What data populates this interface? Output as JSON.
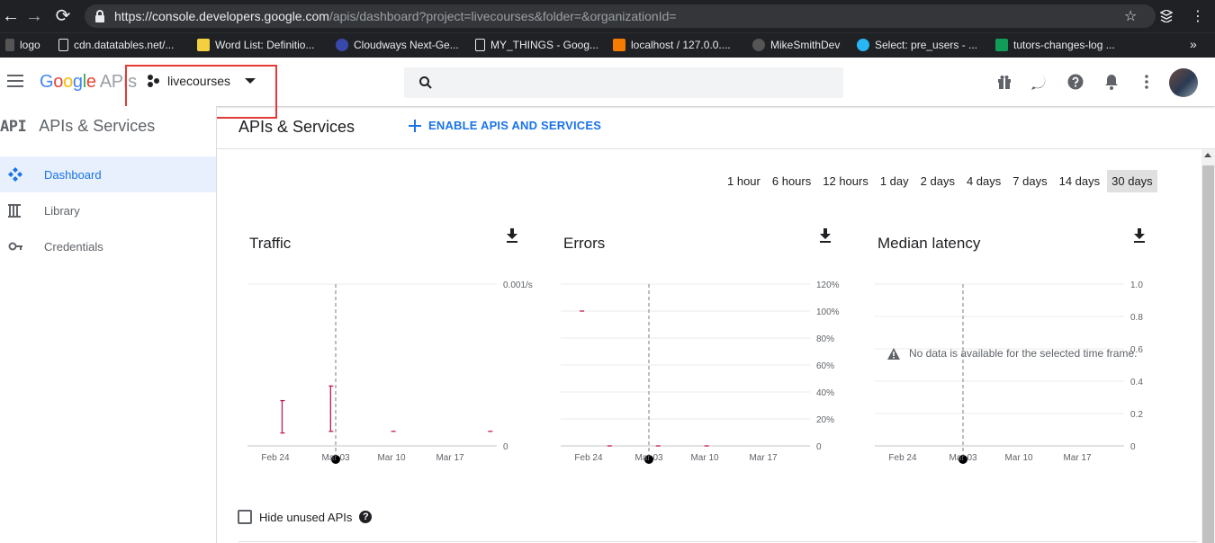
{
  "browser": {
    "url_main": "https://console.developers.google.com",
    "url_rest": "/apis/dashboard?project=livecourses&folder=&organizationId=",
    "bookmarks": [
      {
        "label": "logo"
      },
      {
        "label": "cdn.datatables.net/..."
      },
      {
        "label": "Word List: Definitio..."
      },
      {
        "label": "Cloudways Next-Ge..."
      },
      {
        "label": "MY_THINGS - Goog..."
      },
      {
        "label": "localhost / 127.0.0...."
      },
      {
        "label": "MikeSmithDev"
      },
      {
        "label": "Select: pre_users - ..."
      },
      {
        "label": "tutors-changes-log ..."
      }
    ],
    "overflow_label": "»"
  },
  "header": {
    "logo_google": "Google",
    "logo_apis": "APIs",
    "project_name": "livecourses",
    "search_placeholder": ""
  },
  "sidebar": {
    "badge": "API",
    "title": "APIs & Services",
    "items": [
      {
        "label": "Dashboard",
        "icon": "dashboard-icon",
        "active": true
      },
      {
        "label": "Library",
        "icon": "library-icon",
        "active": false
      },
      {
        "label": "Credentials",
        "icon": "key-icon",
        "active": false
      }
    ]
  },
  "main": {
    "title": "APIs & Services",
    "enable_label": "ENABLE APIS AND SERVICES",
    "time_ranges": [
      "1 hour",
      "6 hours",
      "12 hours",
      "1 day",
      "2 days",
      "4 days",
      "7 days",
      "14 days",
      "30 days"
    ],
    "time_selected": "30 days",
    "hide_unused_label": "Hide unused APIs"
  },
  "chart_data": [
    {
      "type": "line",
      "title": "Traffic",
      "x_ticks": [
        "Feb 24",
        "Mar 03",
        "Mar 10",
        "Mar 17"
      ],
      "y_ticks": [
        "0.001/s",
        "0"
      ],
      "ylim": [
        0,
        0.001
      ],
      "grid": true,
      "series": [
        {
          "values": [
            {
              "x": "Feb 22",
              "y": 0.00028
            },
            {
              "x": "Feb 22",
              "y": 8e-05
            },
            {
              "x": "Mar 01",
              "y": 0.00037
            },
            {
              "x": "Mar 01",
              "y": 9e-05
            },
            {
              "x": "Mar 10",
              "y": 9e-05
            },
            {
              "x": "Mar 24",
              "y": 9e-05
            }
          ]
        }
      ]
    },
    {
      "type": "line",
      "title": "Errors",
      "x_ticks": [
        "Feb 24",
        "Mar 03",
        "Mar 10",
        "Mar 17"
      ],
      "y_ticks": [
        "120%",
        "100%",
        "80%",
        "60%",
        "40%",
        "20%",
        "0"
      ],
      "ylim": [
        0,
        120
      ],
      "grid": true,
      "series": [
        {
          "values": [
            {
              "x": "Feb 20",
              "y": 100
            },
            {
              "x": "Feb 24",
              "y": 0
            },
            {
              "x": "Mar 03",
              "y": 0
            },
            {
              "x": "Mar 10",
              "y": 0
            }
          ]
        }
      ]
    },
    {
      "type": "line",
      "title": "Median latency",
      "x_ticks": [
        "Feb 24",
        "Mar 03",
        "Mar 10",
        "Mar 17"
      ],
      "y_ticks": [
        "1.0",
        "0.8",
        "0.6",
        "0.4",
        "0.2",
        "0"
      ],
      "ylim": [
        0,
        1.0
      ],
      "grid": true,
      "series": [],
      "no_data_message": "No data is available for the selected time frame."
    }
  ],
  "colors": {
    "series": "#c2185b",
    "accent": "#1a73e8",
    "highlight_box": "#e53935"
  }
}
